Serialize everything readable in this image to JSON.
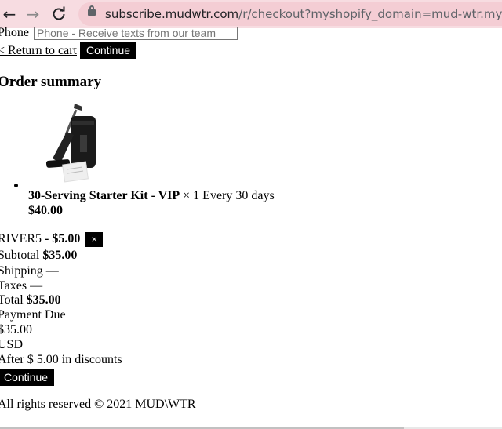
{
  "browser": {
    "url_host": "subscribe.mudwtr.com",
    "url_path": "/r/checkout?myshopify_domain=mud-wtr.myshopify.com"
  },
  "form": {
    "phone_label": "Phone",
    "phone_placeholder": "Phone - Receive texts from our team",
    "return_link": "< Return to cart",
    "continue_label": "Continue"
  },
  "summary": {
    "heading": "Order summary",
    "item": {
      "name": "30-Serving Starter Kit - VIP",
      "quantity_text": "× 1 Every 30 days",
      "price": "$40.00"
    },
    "discount": {
      "code": "RIVER5",
      "separator": " - ",
      "amount": "$5.00",
      "remove_label": "×"
    },
    "subtotal_label": "Subtotal",
    "subtotal_value": "$35.00",
    "shipping_text": "Shipping —",
    "taxes_text": "Taxes —",
    "total_label": "Total",
    "total_value": "$35.00",
    "payment_due_label": "Payment Due",
    "payment_due_value": "$35.00",
    "currency": "USD",
    "discount_note": "After $ 5.00 in discounts",
    "continue_label": "Continue"
  },
  "footer": {
    "rights_text": "All rights reserved © 2021",
    "brand_link": "MUD\\WTR"
  }
}
